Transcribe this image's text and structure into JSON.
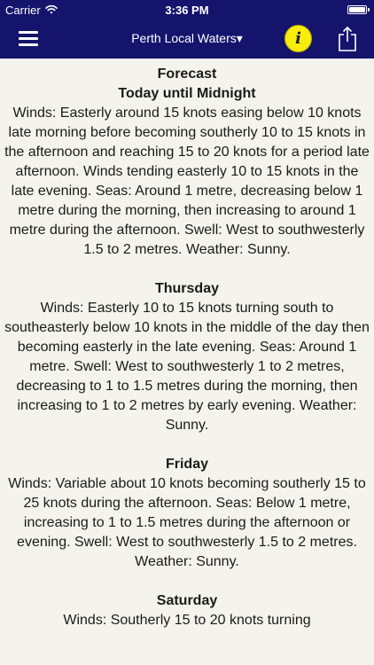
{
  "status_bar": {
    "carrier": "Carrier",
    "time": "3:36 PM",
    "wifi_icon": "wifi-icon",
    "battery_icon": "battery-icon",
    "battery_level": 1.0
  },
  "nav": {
    "title": "Perth Local Waters▾",
    "menu_icon": "hamburger-menu-icon",
    "info_label": "i",
    "share_icon": "share-icon",
    "colors": {
      "bar": "#15146d",
      "info_button": "#f7ed0c"
    }
  },
  "forecast": {
    "heading": "Forecast",
    "sections": [
      {
        "title": "Today until Midnight",
        "text": "Winds: Easterly around 15 knots easing below 10 knots late morning before becoming southerly 10 to 15 knots in the afternoon and reaching 15 to 20 knots for a period late afternoon. Winds tending easterly 10 to 15 knots in the late evening. Seas: Around 1 metre, decreasing below 1 metre during the morning, then increasing to around 1 metre during the afternoon. Swell: West to southwesterly 1.5 to 2 metres. Weather: Sunny."
      },
      {
        "title": "Thursday",
        "text": "Winds: Easterly 10 to 15 knots turning south to southeasterly below 10 knots in the middle of the day then becoming easterly in the late evening. Seas: Around 1 metre. Swell: West to southwesterly 1 to 2 metres, decreasing to 1 to 1.5 metres during the morning, then increasing to 1 to 2 metres by early evening. Weather: Sunny."
      },
      {
        "title": "Friday",
        "text": "Winds: Variable about 10 knots becoming southerly 15 to 25 knots during the afternoon. Seas: Below 1 metre, increasing to 1 to 1.5 metres during the afternoon or evening. Swell: West to southwesterly 1.5 to 2 metres. Weather: Sunny."
      },
      {
        "title": "Saturday",
        "text": "Winds: Southerly 15 to 20 knots turning"
      }
    ]
  }
}
